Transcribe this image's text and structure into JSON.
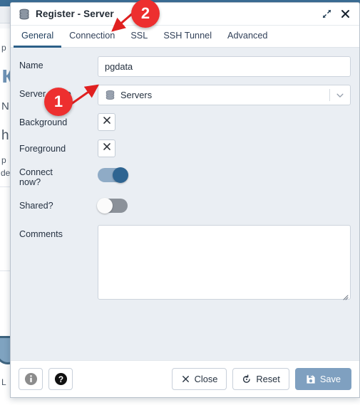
{
  "window": {
    "title": "Register - Server",
    "title_icon": "server-stack-icon",
    "maximize_label": "maximize-icon",
    "close_label": "close-icon"
  },
  "tabs": [
    {
      "id": "general",
      "label": "General",
      "active": true
    },
    {
      "id": "connection",
      "label": "Connection",
      "active": false
    },
    {
      "id": "ssl",
      "label": "SSL",
      "active": false
    },
    {
      "id": "ssh-tunnel",
      "label": "SSH Tunnel",
      "active": false
    },
    {
      "id": "advanced",
      "label": "Advanced",
      "active": false
    }
  ],
  "form": {
    "name": {
      "label": "Name",
      "value": "pgdata",
      "placeholder": ""
    },
    "server_group": {
      "label": "Server group",
      "value": "Servers",
      "icon": "server-group-icon",
      "options": [
        "Servers"
      ]
    },
    "background": {
      "label": "Background",
      "swatch_icon": "clear-color-x-icon",
      "value": ""
    },
    "foreground": {
      "label": "Foreground",
      "swatch_icon": "clear-color-x-icon",
      "value": ""
    },
    "connect_now": {
      "label": "Connect now?",
      "label_line1": "Connect",
      "label_line2": "now?",
      "state": "on"
    },
    "shared": {
      "label": "Shared?",
      "state": "off"
    },
    "comments": {
      "label": "Comments",
      "value": "",
      "placeholder": ""
    }
  },
  "footer": {
    "info_label": "info-icon",
    "help_label": "help-icon",
    "close_label": "Close",
    "reset_label": "Reset",
    "save_label": "Save"
  },
  "annotations": [
    {
      "id": "badge-1",
      "number": "1",
      "points_to": "server-group-select"
    },
    {
      "id": "badge-2",
      "number": "2",
      "points_to": "tab-connection"
    }
  ],
  "colors": {
    "accent": "#2c5f88",
    "topbar": "#3c6e96",
    "form_bg": "#eaeef3",
    "save_button": "#7fa0c0",
    "annotation_red": "#ed2f2f",
    "toggle_on_knob": "#2e6491",
    "toggle_on_track": "#8fabc6",
    "toggle_off_track": "#8b9199"
  },
  "backdrop": {
    "fragments": [
      "p",
      "N",
      "h",
      "p",
      "de",
      "L"
    ]
  }
}
